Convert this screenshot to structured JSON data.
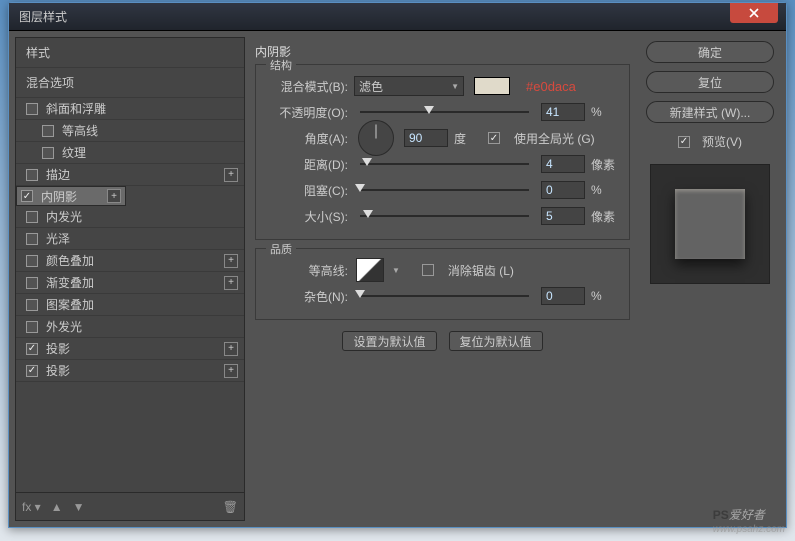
{
  "window": {
    "title": "图层样式"
  },
  "sidebar": {
    "header1": "样式",
    "header2": "混合选项",
    "items": [
      {
        "label": "斜面和浮雕",
        "checked": false,
        "plus": false,
        "lvl": 0
      },
      {
        "label": "等高线",
        "checked": false,
        "plus": false,
        "lvl": 1
      },
      {
        "label": "纹理",
        "checked": false,
        "plus": false,
        "lvl": 1
      },
      {
        "label": "描边",
        "checked": false,
        "plus": true,
        "lvl": 0
      },
      {
        "label": "内阴影",
        "checked": true,
        "plus": true,
        "lvl": 0,
        "selected": true
      },
      {
        "label": "内发光",
        "checked": false,
        "plus": false,
        "lvl": 0
      },
      {
        "label": "光泽",
        "checked": false,
        "plus": false,
        "lvl": 0
      },
      {
        "label": "颜色叠加",
        "checked": false,
        "plus": true,
        "lvl": 0
      },
      {
        "label": "渐变叠加",
        "checked": false,
        "plus": true,
        "lvl": 0
      },
      {
        "label": "图案叠加",
        "checked": false,
        "plus": false,
        "lvl": 0
      },
      {
        "label": "外发光",
        "checked": false,
        "plus": false,
        "lvl": 0
      },
      {
        "label": "投影",
        "checked": true,
        "plus": true,
        "lvl": 0
      },
      {
        "label": "投影",
        "checked": true,
        "plus": true,
        "lvl": 0
      }
    ],
    "fx": "fx"
  },
  "main": {
    "title": "内阴影",
    "struct_title": "结构",
    "quality_title": "品质",
    "blend_label": "混合模式(B):",
    "blend_value": "滤色",
    "color_hex": "#e0daca",
    "opacity_label": "不透明度(O):",
    "opacity_value": "41",
    "opacity_unit": "%",
    "angle_label": "角度(A):",
    "angle_value": "90",
    "angle_unit": "度",
    "global_label": "使用全局光 (G)",
    "distance_label": "距离(D):",
    "distance_value": "4",
    "px_unit": "像素",
    "choke_label": "阻塞(C):",
    "choke_value": "0",
    "pct_unit": "%",
    "size_label": "大小(S):",
    "size_value": "5",
    "contour_label": "等高线:",
    "antialias_label": "消除锯齿 (L)",
    "noise_label": "杂色(N):",
    "noise_value": "0",
    "btn_default": "设置为默认值",
    "btn_reset": "复位为默认值"
  },
  "right": {
    "ok": "确定",
    "cancel": "复位",
    "newstyle": "新建样式 (W)...",
    "preview": "预览(V)"
  },
  "watermark": {
    "a": "PS",
    "b": "爱好者",
    "c": "www.psahz.com"
  }
}
